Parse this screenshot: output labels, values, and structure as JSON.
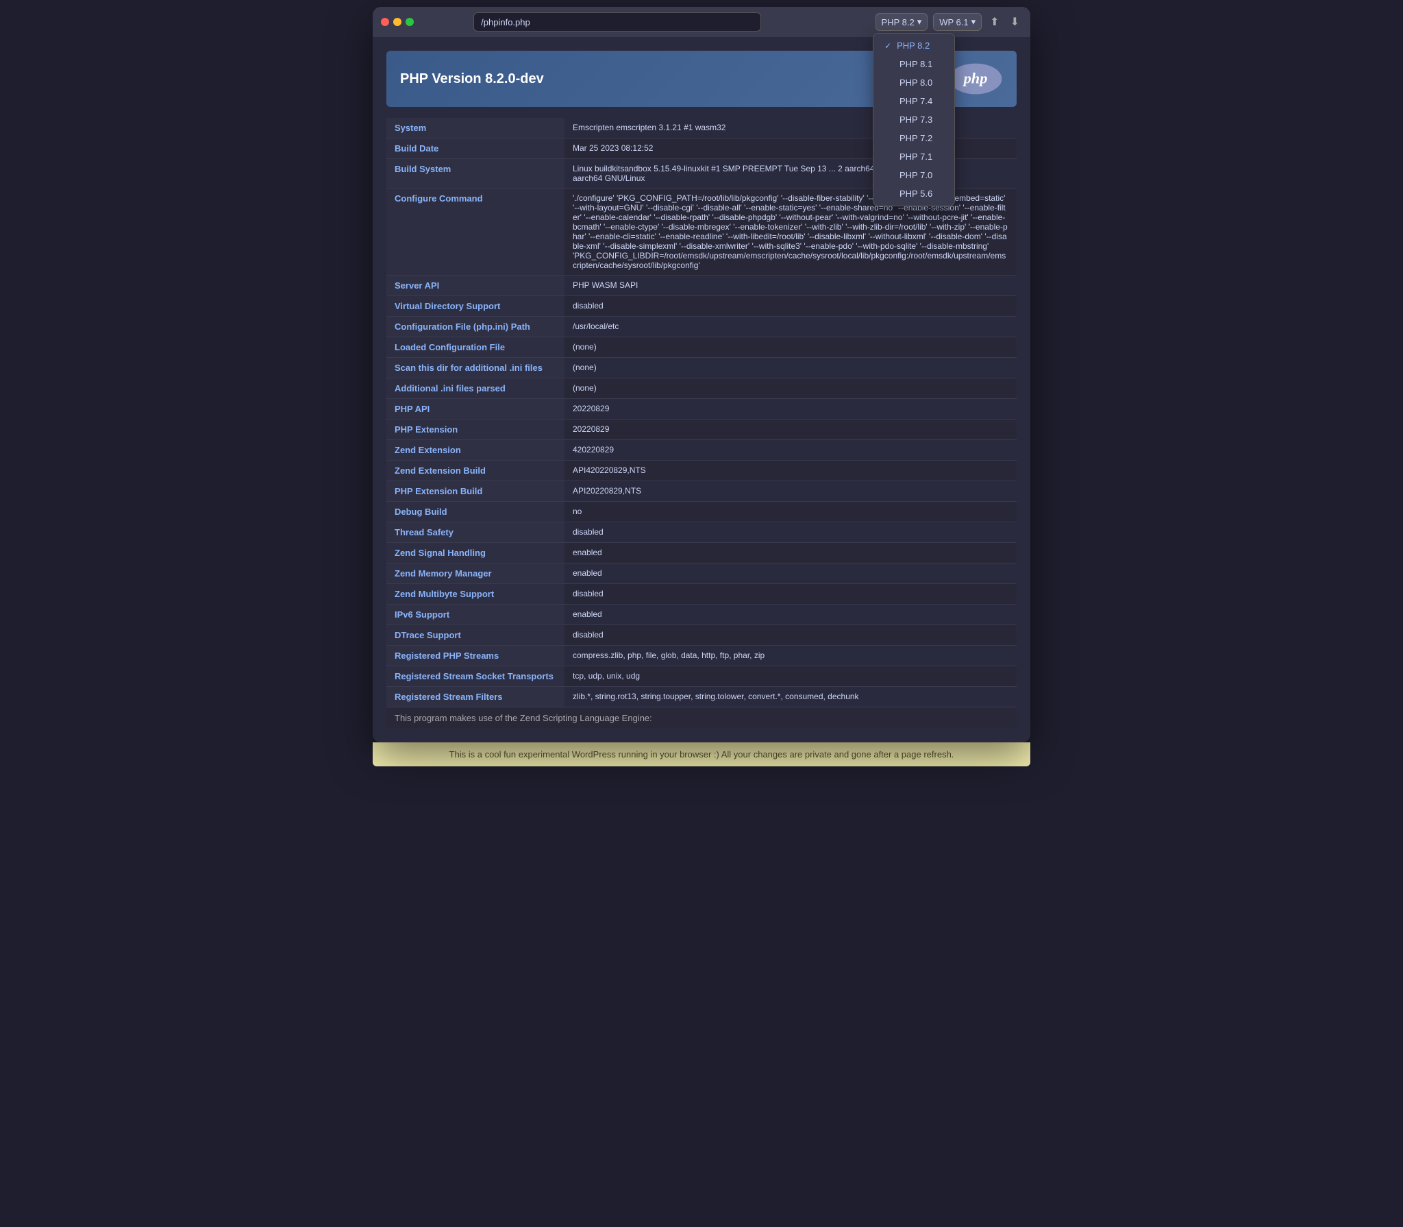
{
  "titlebar": {
    "url": "/phpinfo.php",
    "php_version_current": "PHP 8.2",
    "wp_version": "WP 6.1",
    "checkmark": "✓"
  },
  "dropdown": {
    "versions": [
      {
        "label": "PHP 8.2",
        "selected": true
      },
      {
        "label": "PHP 8.1",
        "selected": false
      },
      {
        "label": "PHP 8.0",
        "selected": false
      },
      {
        "label": "PHP 7.4",
        "selected": false
      },
      {
        "label": "PHP 7.3",
        "selected": false
      },
      {
        "label": "PHP 7.2",
        "selected": false
      },
      {
        "label": "PHP 7.1",
        "selected": false
      },
      {
        "label": "PHP 7.0",
        "selected": false
      },
      {
        "label": "PHP 5.6",
        "selected": false
      }
    ]
  },
  "php_header": {
    "title": "PHP Version 8.2.0-dev"
  },
  "info_rows": [
    {
      "key": "System",
      "value": "Emscripten emscripten 3.1.21 #1 wasm32"
    },
    {
      "key": "Build Date",
      "value": "Mar 25 2023 08:12:52"
    },
    {
      "key": "Build System",
      "value": "Linux buildkitsandbox 5.15.49-linuxkit #1 SMP PREEMPT Tue Sep 13 ... 2 aarch64 aarch64\naarch64 GNU/Linux"
    },
    {
      "key": "Configure Command",
      "value": "'./configure' 'PKG_CONFIG_PATH=/root/lib/lib/pkgconfig' '--disable-fiber-stability' '--enable-json' '--enable-embed=static' '--with-layout=GNU' '--disable-cgi' '--disable-all' '--enable-static=yes' '--enable-shared=no' '--enable-session' '--enable-filter' '--enable-calendar' '--disable-rpath' '--disable-phpdgb' '--without-pear' '--with-valgrind=no' '--without-pcre-jit' '--enable-bcmath' '--enable-ctype' '--disable-mbregex' '--enable-tokenizer' '--with-zlib' '--with-zlib-dir=/root/lib' '--with-zip' '--enable-phar' '--enable-cli=static' '--enable-readline' '--with-libedit=/root/lib' '--disable-libxml' '--without-libxml' '--disable-dom' '--disable-xml' '--disable-simplexml' '--disable-xmlwriter' '--with-sqlite3' '--enable-pdo' '--with-pdo-sqlite' '--disable-mbstring'\n'PKG_CONFIG_LIBDIR=/root/emsdk/upstream/emscripten/cache/sysroot/local/lib/pkgconfig:/root/emsdk/upstream/emscripten/cache/sysroot/lib/pkgconfig'"
    },
    {
      "key": "Server API",
      "value": "PHP WASM SAPI"
    },
    {
      "key": "Virtual Directory Support",
      "value": "disabled"
    },
    {
      "key": "Configuration File (php.ini) Path",
      "value": "/usr/local/etc"
    },
    {
      "key": "Loaded Configuration File",
      "value": "(none)"
    },
    {
      "key": "Scan this dir for additional .ini files",
      "value": "(none)"
    },
    {
      "key": "Additional .ini files parsed",
      "value": "(none)"
    },
    {
      "key": "PHP API",
      "value": "20220829"
    },
    {
      "key": "PHP Extension",
      "value": "20220829"
    },
    {
      "key": "Zend Extension",
      "value": "420220829"
    },
    {
      "key": "Zend Extension Build",
      "value": "API420220829,NTS"
    },
    {
      "key": "PHP Extension Build",
      "value": "API20220829,NTS"
    },
    {
      "key": "Debug Build",
      "value": "no"
    },
    {
      "key": "Thread Safety",
      "value": "disabled"
    },
    {
      "key": "Zend Signal Handling",
      "value": "enabled"
    },
    {
      "key": "Zend Memory Manager",
      "value": "enabled"
    },
    {
      "key": "Zend Multibyte Support",
      "value": "disabled"
    },
    {
      "key": "IPv6 Support",
      "value": "enabled"
    },
    {
      "key": "DTrace Support",
      "value": "disabled"
    },
    {
      "key": "Registered PHP Streams",
      "value": "compress.zlib, php, file, glob, data, http, ftp, phar, zip"
    },
    {
      "key": "Registered Stream Socket Transports",
      "value": "tcp, udp, unix, udg"
    },
    {
      "key": "Registered Stream Filters",
      "value": "zlib.*, string.rot13, string.toupper, string.tolower, convert.*, consumed, dechunk"
    }
  ],
  "partial_text": "This program makes use of the Zend Scripting Language Engine:",
  "footer": {
    "text": "This is a cool fun experimental WordPress running in your browser :) All your changes are private and gone after a page refresh."
  }
}
